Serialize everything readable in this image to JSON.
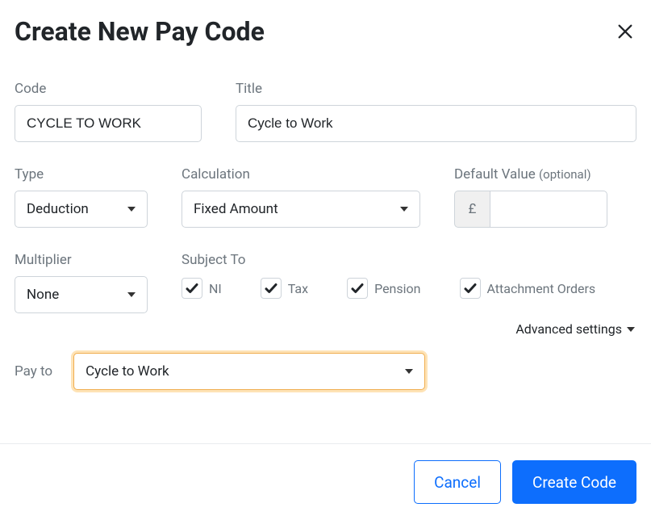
{
  "dialog": {
    "title": "Create New Pay Code"
  },
  "fields": {
    "code": {
      "label": "Code",
      "value": "CYCLE TO WORK"
    },
    "title": {
      "label": "Title",
      "value": "Cycle to Work"
    },
    "type": {
      "label": "Type",
      "value": "Deduction"
    },
    "calculation": {
      "label": "Calculation",
      "value": "Fixed Amount"
    },
    "defaultValue": {
      "label": "Default Value ",
      "optional": "(optional)",
      "currency": "£",
      "value": ""
    },
    "multiplier": {
      "label": "Multiplier",
      "value": "None"
    },
    "subjectTo": {
      "label": "Subject To",
      "items": [
        {
          "label": "NI",
          "checked": true
        },
        {
          "label": "Tax",
          "checked": true
        },
        {
          "label": "Pension",
          "checked": true
        },
        {
          "label": "Attachment Orders",
          "checked": true
        }
      ]
    },
    "payTo": {
      "label": "Pay to",
      "value": "Cycle to Work"
    }
  },
  "advanced": {
    "label": "Advanced settings"
  },
  "buttons": {
    "cancel": "Cancel",
    "create": "Create Code"
  }
}
